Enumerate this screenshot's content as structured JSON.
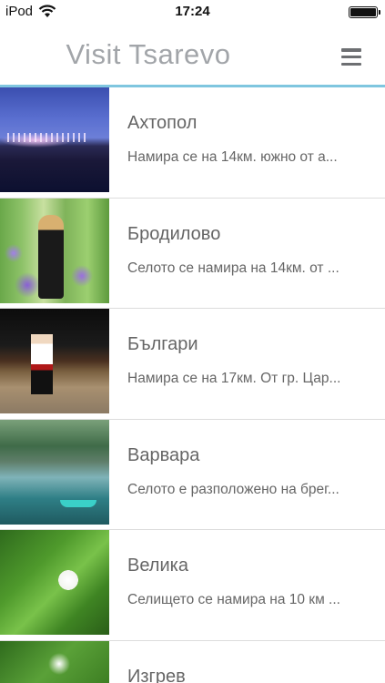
{
  "status_bar": {
    "carrier": "iPod",
    "time": "17:24"
  },
  "header": {
    "title": "Visit Tsarevo",
    "menu_icon": "hamburger-menu-icon",
    "accent_color": "#7fc6df"
  },
  "places": [
    {
      "title": "Ахтопол",
      "description": "Намира се на 14км. южно от а..."
    },
    {
      "title": "Бродилово",
      "description": "Селото се намира на 14км. от ..."
    },
    {
      "title": "Българи",
      "description": "Намира се на 17км. От гр. Цар..."
    },
    {
      "title": "Варвара",
      "description": "Селото е разположено на брег..."
    },
    {
      "title": "Велика",
      "description": "Селището се намира на 10 км ..."
    },
    {
      "title": "Изгрев",
      "description": ""
    }
  ]
}
